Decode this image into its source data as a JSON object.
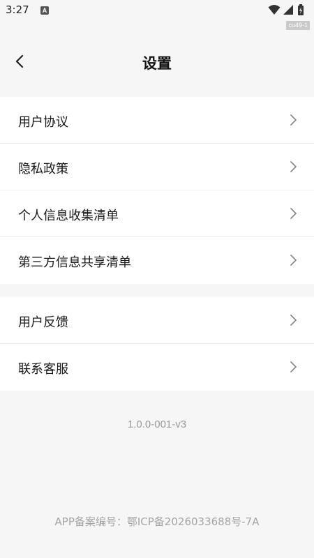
{
  "status_bar": {
    "time": "3:27",
    "app_icon_letter": "A",
    "tag": "cu49-1"
  },
  "header": {
    "title": "设置"
  },
  "groups": [
    {
      "items": [
        {
          "label": "用户协议"
        },
        {
          "label": "隐私政策"
        },
        {
          "label": "个人信息收集清单"
        },
        {
          "label": "第三方信息共享清单"
        }
      ]
    },
    {
      "items": [
        {
          "label": "用户反馈"
        },
        {
          "label": "联系客服"
        }
      ]
    }
  ],
  "footer": {
    "version": "1.0.0-001-v3",
    "filing": "APP备案编号：鄂ICP备2026033688号-7A"
  },
  "colors": {
    "background": "#f6f6f6",
    "card": "#ffffff",
    "muted_text": "#9a9a9a"
  }
}
